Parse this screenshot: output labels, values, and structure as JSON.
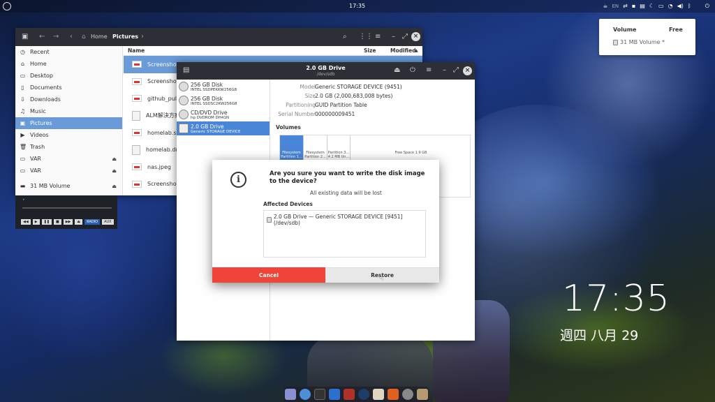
{
  "top_panel": {
    "time": "17:35",
    "lang": "EN"
  },
  "volume_popup": {
    "col_volume": "Volume",
    "col_free": "Free",
    "row_label": "31 MB Volume *"
  },
  "file_manager": {
    "breadcrumb": [
      "Home",
      "Pictures"
    ],
    "sidebar": [
      {
        "label": "Recent",
        "icon": "clock-icon"
      },
      {
        "label": "Home",
        "icon": "home-icon"
      },
      {
        "label": "Desktop",
        "icon": "desktop-icon"
      },
      {
        "label": "Documents",
        "icon": "documents-icon"
      },
      {
        "label": "Downloads",
        "icon": "download-icon"
      },
      {
        "label": "Music",
        "icon": "music-icon"
      },
      {
        "label": "Pictures",
        "icon": "pictures-icon",
        "active": true
      },
      {
        "label": "Videos",
        "icon": "videos-icon"
      },
      {
        "label": "Trash",
        "icon": "trash-icon"
      },
      {
        "label": "VAR",
        "icon": "drive-icon",
        "eject": true
      },
      {
        "label": "VAR",
        "icon": "drive-icon",
        "eject": true
      },
      {
        "label": "31 MB Volume",
        "icon": "drive-icon",
        "eject": true
      }
    ],
    "columns": {
      "name": "Name",
      "size": "Size",
      "modified": "Modified"
    },
    "files": [
      {
        "name": "Screenshot f",
        "type": "image",
        "selected": true
      },
      {
        "name": "Screenshot f",
        "type": "image"
      },
      {
        "name": "github_pull.p",
        "type": "image"
      },
      {
        "name": "ALM解決方案",
        "type": "doc"
      },
      {
        "name": "homelab.svg",
        "type": "image"
      },
      {
        "name": "homelab.dra",
        "type": "doc"
      },
      {
        "name": "nas.jpeg",
        "type": "image"
      },
      {
        "name": "Screenshot f",
        "type": "image"
      }
    ]
  },
  "player": {
    "btn_radio": "RADIO",
    "btn_aux": "AUX"
  },
  "disks": {
    "title": "2.0 GB Drive",
    "subtitle": "/dev/sdb",
    "devices": [
      {
        "line1": "256 GB Disk",
        "line2": "INTEL SSDPEKKW256G8"
      },
      {
        "line1": "256 GB Disk",
        "line2": "INTEL SSDSC2KW256G8"
      },
      {
        "line1": "CD/DVD Drive",
        "line2": "hp       DVDROM DH41N"
      },
      {
        "line1": "2.0 GB Drive",
        "line2": "Generic STORAGE DEVICE",
        "active": true
      }
    ],
    "props": [
      {
        "key": "Model",
        "value": "Generic STORAGE DEVICE (9451)"
      },
      {
        "key": "Size",
        "value": "2.0 GB (2,000,683,008 bytes)"
      },
      {
        "key": "Partitioning",
        "value": "GUID Partition Table"
      },
      {
        "key": "Serial Number",
        "value": "000000009451"
      }
    ],
    "volumes_label": "Volumes",
    "segments": [
      {
        "label": "Filesystem Partition 1...",
        "selected": true
      },
      {
        "label": "Filesystem Partition 2..."
      },
      {
        "label": "Partition 3... 4.2 MB Un..."
      },
      {
        "label": "Free Space 1.9 GB"
      }
    ]
  },
  "dialog": {
    "title": "Are you sure you want to write the disk image to the device?",
    "subtitle": "All existing data will be lost",
    "affected_label": "Affected Devices",
    "affected_item": "2.0 GB Drive — Generic STORAGE DEVICE [9451] (/dev/sdb)",
    "cancel": "Cancel",
    "restore": "Restore"
  },
  "desktop_clock": {
    "time": "17:35",
    "date": "週四 八月 29"
  },
  "colors": {
    "accent": "#6a9bd8",
    "cancel": "#f04438",
    "titlebar": "#2c3036"
  }
}
